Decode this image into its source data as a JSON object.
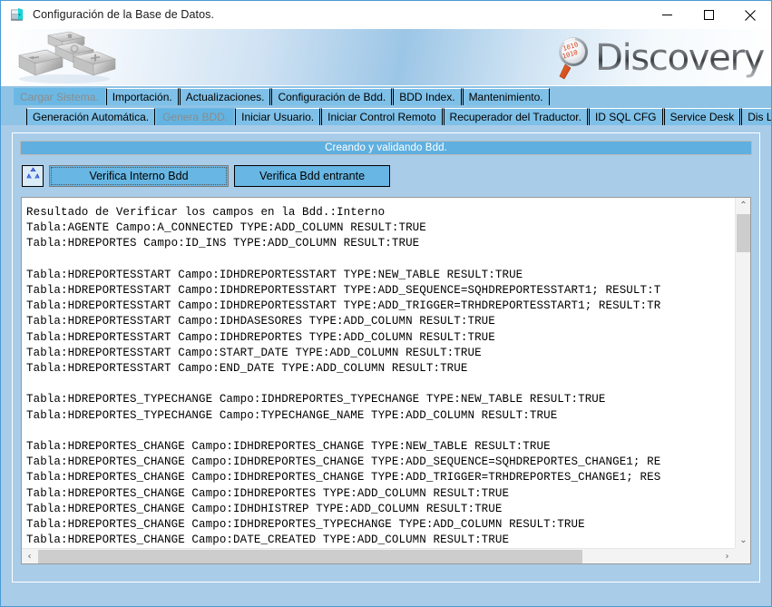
{
  "window": {
    "title": "Configuración de la Base de Datos.",
    "icon": "database-config-icon",
    "minimize_label": "−",
    "maximize_label": "□",
    "close_label": "✕",
    "border_color": "#4a9ad4"
  },
  "banner": {
    "logo_text": "Discovery",
    "logo_mark": "magnifier-binary-icon",
    "decoration": "keyboard-keys-image"
  },
  "tabs_primary": {
    "active_index": 0,
    "items": [
      {
        "label": "Cargar Sistema.",
        "active": true
      },
      {
        "label": "Importación.",
        "active": false
      },
      {
        "label": "Actualizaciones.",
        "active": false
      },
      {
        "label": "Configuración de Bdd.",
        "active": false
      },
      {
        "label": "BDD Index.",
        "active": false
      },
      {
        "label": "Mantenimiento.",
        "active": false
      }
    ]
  },
  "tabs_secondary": {
    "active_index": 1,
    "items": [
      {
        "label": "Generación Automática.",
        "active": false
      },
      {
        "label": "Genera BDD.",
        "active": true
      },
      {
        "label": "Iniciar Usuario.",
        "active": false
      },
      {
        "label": "Iniciar Control Remoto",
        "active": false
      },
      {
        "label": "Recuperador del Traductor.",
        "active": false
      },
      {
        "label": "ID SQL CFG",
        "active": false
      },
      {
        "label": "Service Desk",
        "active": false
      },
      {
        "label": "Dis Log",
        "active": false
      }
    ]
  },
  "status": {
    "text": "Creando y validando Bdd.",
    "background": "#5fb0e0",
    "text_color": "#ffffff"
  },
  "toolbar": {
    "refresh_icon": "recycle-refresh-icon",
    "verifica_interno_label": "Verifica Interno Bdd",
    "verifica_entrante_label": "Verifica Bdd entrante",
    "button_color": "#67b6e3"
  },
  "log": {
    "content": "Resultado de Verificar los campos en la Bdd.:Interno\nTabla:AGENTE Campo:A_CONNECTED TYPE:ADD_COLUMN RESULT:TRUE\nTabla:HDREPORTES Campo:ID_INS TYPE:ADD_COLUMN RESULT:TRUE\n\nTabla:HDREPORTESSTART Campo:IDHDREPORTESSTART TYPE:NEW_TABLE RESULT:TRUE\nTabla:HDREPORTESSTART Campo:IDHDREPORTESSTART TYPE:ADD_SEQUENCE=SQHDREPORTESSTART1; RESULT:T\nTabla:HDREPORTESSTART Campo:IDHDREPORTESSTART TYPE:ADD_TRIGGER=TRHDREPORTESSTART1; RESULT:TR\nTabla:HDREPORTESSTART Campo:IDHDASESORES TYPE:ADD_COLUMN RESULT:TRUE\nTabla:HDREPORTESSTART Campo:IDHDREPORTES TYPE:ADD_COLUMN RESULT:TRUE\nTabla:HDREPORTESSTART Campo:START_DATE TYPE:ADD_COLUMN RESULT:TRUE\nTabla:HDREPORTESSTART Campo:END_DATE TYPE:ADD_COLUMN RESULT:TRUE\n\nTabla:HDREPORTES_TYPECHANGE Campo:IDHDREPORTES_TYPECHANGE TYPE:NEW_TABLE RESULT:TRUE\nTabla:HDREPORTES_TYPECHANGE Campo:TYPECHANGE_NAME TYPE:ADD_COLUMN RESULT:TRUE\n\nTabla:HDREPORTES_CHANGE Campo:IDHDREPORTES_CHANGE TYPE:NEW_TABLE RESULT:TRUE\nTabla:HDREPORTES_CHANGE Campo:IDHDREPORTES_CHANGE TYPE:ADD_SEQUENCE=SQHDREPORTES_CHANGE1; RE\nTabla:HDREPORTES_CHANGE Campo:IDHDREPORTES_CHANGE TYPE:ADD_TRIGGER=TRHDREPORTES_CHANGE1; RES\nTabla:HDREPORTES_CHANGE Campo:IDHDREPORTES TYPE:ADD_COLUMN RESULT:TRUE\nTabla:HDREPORTES_CHANGE Campo:IDHDHISTREP TYPE:ADD_COLUMN RESULT:TRUE\nTabla:HDREPORTES_CHANGE Campo:IDHDREPORTES_TYPECHANGE TYPE:ADD_COLUMN RESULT:TRUE\nTabla:HDREPORTES_CHANGE Campo:DATE_CREATED TYPE:ADD_COLUMN RESULT:TRUE\nTabla:HDREPORTES_CHANGE Campo:IDHDASESORES TYPE:ADD_COLUMN RESULT:TRUE"
  },
  "scrollbars": {
    "up_arrow": "⌃",
    "down_arrow": "⌄",
    "left_arrow": "‹",
    "right_arrow": "›"
  }
}
